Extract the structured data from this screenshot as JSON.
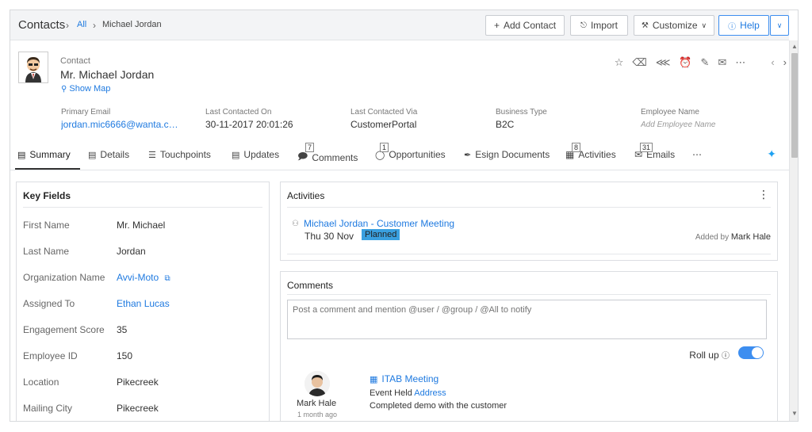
{
  "breadcrumb": {
    "title": "Contacts",
    "all_link": "All",
    "current": "Michael Jordan"
  },
  "toolbar": {
    "add_contact": "Add Contact",
    "import": "Import",
    "customize": "Customize",
    "help": "Help"
  },
  "contact": {
    "type_label": "Contact",
    "name": "Mr. Michael Jordan",
    "show_map": "Show Map"
  },
  "summary_fields": [
    {
      "label": "Primary Email",
      "value": "jordan.mic6666@wanta.co..."
    },
    {
      "label": "Last Contacted On",
      "value": "30-11-2017 20:01:26"
    },
    {
      "label": "Last Contacted Via",
      "value": "CustomerPortal"
    },
    {
      "label": "Business Type",
      "value": "B2C"
    },
    {
      "label": "Employee Name",
      "value": "Add Employee Name"
    }
  ],
  "tabs": [
    {
      "label": "Summary"
    },
    {
      "label": "Details"
    },
    {
      "label": "Touchpoints"
    },
    {
      "label": "Updates"
    },
    {
      "label": "Comments",
      "badge": "7"
    },
    {
      "label": "Opportunities",
      "badge": "1"
    },
    {
      "label": "Esign Documents"
    },
    {
      "label": "Activities",
      "badge": "8"
    },
    {
      "label": "Emails",
      "badge": "31"
    }
  ],
  "key_fields": {
    "title": "Key Fields",
    "rows": [
      {
        "label": "First Name",
        "value": "Mr. Michael"
      },
      {
        "label": "Last Name",
        "value": "Jordan"
      },
      {
        "label": "Organization Name",
        "value": "Avvi-Moto"
      },
      {
        "label": "Assigned To",
        "value": "Ethan Lucas"
      },
      {
        "label": "Engagement Score",
        "value": "35"
      },
      {
        "label": "Employee ID",
        "value": "150"
      },
      {
        "label": "Location",
        "value": "Pikecreek"
      },
      {
        "label": "Mailing City",
        "value": "Pikecreek"
      }
    ]
  },
  "activities": {
    "title": "Activities",
    "item": {
      "title": "Michael Jordan - Customer Meeting",
      "date": "Thu 30 Nov",
      "status": "Planned",
      "added_by_label": "Added by",
      "added_by_name": "Mark Hale"
    }
  },
  "comments": {
    "title": "Comments",
    "placeholder": "Post a comment and mention @user / @group / @All to notify",
    "rollup_label": "Roll up",
    "item": {
      "author": "Mark Hale",
      "time": "1 month ago",
      "title": "ITAB Meeting",
      "line1_prefix": "Event Held",
      "line1_link": "Address",
      "line2": "Completed demo with the customer"
    }
  },
  "colors": {
    "accent": "#1f7ae0",
    "planned_badge": "#3aa0e0",
    "toggle": "#3d8ef0"
  }
}
